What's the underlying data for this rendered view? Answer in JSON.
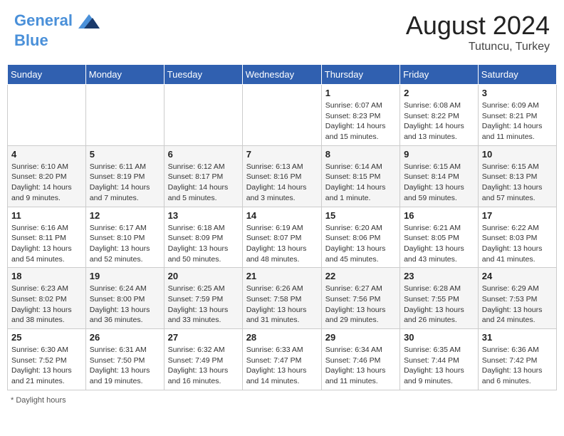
{
  "header": {
    "logo_line1": "General",
    "logo_line2": "Blue",
    "month_year": "August 2024",
    "location": "Tutuncu, Turkey"
  },
  "days_of_week": [
    "Sunday",
    "Monday",
    "Tuesday",
    "Wednesday",
    "Thursday",
    "Friday",
    "Saturday"
  ],
  "footer_note": "Daylight hours",
  "weeks": [
    [
      {
        "day": "",
        "info": ""
      },
      {
        "day": "",
        "info": ""
      },
      {
        "day": "",
        "info": ""
      },
      {
        "day": "",
        "info": ""
      },
      {
        "day": "1",
        "info": "Sunrise: 6:07 AM\nSunset: 8:23 PM\nDaylight: 14 hours\nand 15 minutes."
      },
      {
        "day": "2",
        "info": "Sunrise: 6:08 AM\nSunset: 8:22 PM\nDaylight: 14 hours\nand 13 minutes."
      },
      {
        "day": "3",
        "info": "Sunrise: 6:09 AM\nSunset: 8:21 PM\nDaylight: 14 hours\nand 11 minutes."
      }
    ],
    [
      {
        "day": "4",
        "info": "Sunrise: 6:10 AM\nSunset: 8:20 PM\nDaylight: 14 hours\nand 9 minutes."
      },
      {
        "day": "5",
        "info": "Sunrise: 6:11 AM\nSunset: 8:19 PM\nDaylight: 14 hours\nand 7 minutes."
      },
      {
        "day": "6",
        "info": "Sunrise: 6:12 AM\nSunset: 8:17 PM\nDaylight: 14 hours\nand 5 minutes."
      },
      {
        "day": "7",
        "info": "Sunrise: 6:13 AM\nSunset: 8:16 PM\nDaylight: 14 hours\nand 3 minutes."
      },
      {
        "day": "8",
        "info": "Sunrise: 6:14 AM\nSunset: 8:15 PM\nDaylight: 14 hours\nand 1 minute."
      },
      {
        "day": "9",
        "info": "Sunrise: 6:15 AM\nSunset: 8:14 PM\nDaylight: 13 hours\nand 59 minutes."
      },
      {
        "day": "10",
        "info": "Sunrise: 6:15 AM\nSunset: 8:13 PM\nDaylight: 13 hours\nand 57 minutes."
      }
    ],
    [
      {
        "day": "11",
        "info": "Sunrise: 6:16 AM\nSunset: 8:11 PM\nDaylight: 13 hours\nand 54 minutes."
      },
      {
        "day": "12",
        "info": "Sunrise: 6:17 AM\nSunset: 8:10 PM\nDaylight: 13 hours\nand 52 minutes."
      },
      {
        "day": "13",
        "info": "Sunrise: 6:18 AM\nSunset: 8:09 PM\nDaylight: 13 hours\nand 50 minutes."
      },
      {
        "day": "14",
        "info": "Sunrise: 6:19 AM\nSunset: 8:07 PM\nDaylight: 13 hours\nand 48 minutes."
      },
      {
        "day": "15",
        "info": "Sunrise: 6:20 AM\nSunset: 8:06 PM\nDaylight: 13 hours\nand 45 minutes."
      },
      {
        "day": "16",
        "info": "Sunrise: 6:21 AM\nSunset: 8:05 PM\nDaylight: 13 hours\nand 43 minutes."
      },
      {
        "day": "17",
        "info": "Sunrise: 6:22 AM\nSunset: 8:03 PM\nDaylight: 13 hours\nand 41 minutes."
      }
    ],
    [
      {
        "day": "18",
        "info": "Sunrise: 6:23 AM\nSunset: 8:02 PM\nDaylight: 13 hours\nand 38 minutes."
      },
      {
        "day": "19",
        "info": "Sunrise: 6:24 AM\nSunset: 8:00 PM\nDaylight: 13 hours\nand 36 minutes."
      },
      {
        "day": "20",
        "info": "Sunrise: 6:25 AM\nSunset: 7:59 PM\nDaylight: 13 hours\nand 33 minutes."
      },
      {
        "day": "21",
        "info": "Sunrise: 6:26 AM\nSunset: 7:58 PM\nDaylight: 13 hours\nand 31 minutes."
      },
      {
        "day": "22",
        "info": "Sunrise: 6:27 AM\nSunset: 7:56 PM\nDaylight: 13 hours\nand 29 minutes."
      },
      {
        "day": "23",
        "info": "Sunrise: 6:28 AM\nSunset: 7:55 PM\nDaylight: 13 hours\nand 26 minutes."
      },
      {
        "day": "24",
        "info": "Sunrise: 6:29 AM\nSunset: 7:53 PM\nDaylight: 13 hours\nand 24 minutes."
      }
    ],
    [
      {
        "day": "25",
        "info": "Sunrise: 6:30 AM\nSunset: 7:52 PM\nDaylight: 13 hours\nand 21 minutes."
      },
      {
        "day": "26",
        "info": "Sunrise: 6:31 AM\nSunset: 7:50 PM\nDaylight: 13 hours\nand 19 minutes."
      },
      {
        "day": "27",
        "info": "Sunrise: 6:32 AM\nSunset: 7:49 PM\nDaylight: 13 hours\nand 16 minutes."
      },
      {
        "day": "28",
        "info": "Sunrise: 6:33 AM\nSunset: 7:47 PM\nDaylight: 13 hours\nand 14 minutes."
      },
      {
        "day": "29",
        "info": "Sunrise: 6:34 AM\nSunset: 7:46 PM\nDaylight: 13 hours\nand 11 minutes."
      },
      {
        "day": "30",
        "info": "Sunrise: 6:35 AM\nSunset: 7:44 PM\nDaylight: 13 hours\nand 9 minutes."
      },
      {
        "day": "31",
        "info": "Sunrise: 6:36 AM\nSunset: 7:42 PM\nDaylight: 13 hours\nand 6 minutes."
      }
    ]
  ]
}
